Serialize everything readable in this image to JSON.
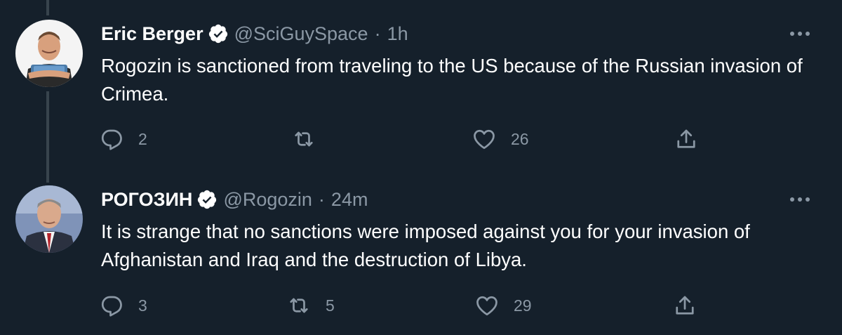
{
  "tweets": [
    {
      "author": {
        "name": "Eric Berger",
        "handle": "@SciGuySpace",
        "verified": true
      },
      "time": "1h",
      "separator": "·",
      "text": "Rogozin is sanctioned from traveling to the US because of the Russian invasion of Crimea.",
      "replies": "2",
      "retweets": "",
      "likes": "26"
    },
    {
      "author": {
        "name": "РОГОЗИН",
        "handle": "@Rogozin",
        "verified": true
      },
      "time": "24m",
      "separator": "·",
      "text": "It is strange that no sanctions were imposed against you for your invasion of Afghanistan and Iraq and the destruction of Libya.",
      "replies": "3",
      "retweets": "5",
      "likes": "29"
    }
  ],
  "colors": {
    "background": "#15202b",
    "secondary_text": "#8b98a5",
    "verified_badge": "#ffffff",
    "thread_line": "#38444d"
  }
}
